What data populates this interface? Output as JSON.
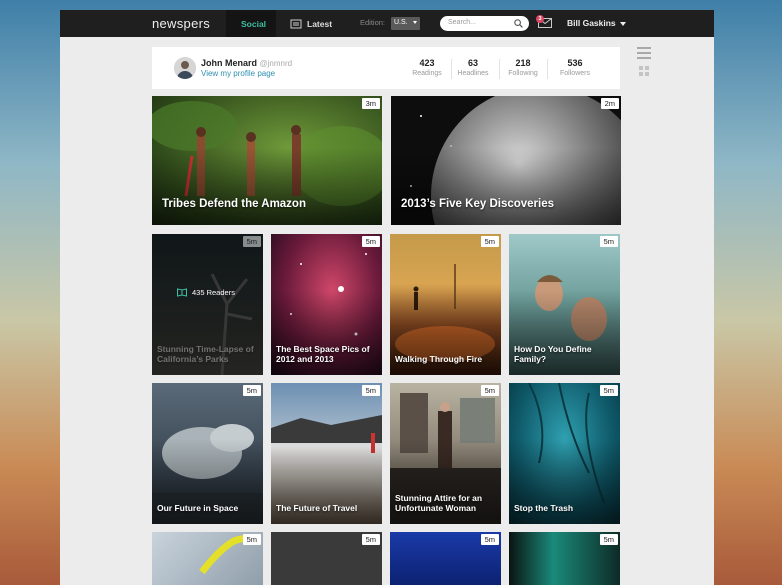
{
  "app": {
    "logo": "newspers",
    "tabs": [
      {
        "label": "Social",
        "active": true
      },
      {
        "label": "Latest",
        "active": false
      }
    ],
    "edition_label": "Edition:",
    "edition_value": "U.S.",
    "search_placeholder": "Search...",
    "notification_count": "3",
    "user_name": "Bill Gaskins",
    "accent_color": "#3fbfa3"
  },
  "profile": {
    "name": "John Menard",
    "handle": "@jnmnrd",
    "link": "View my profile page",
    "stats": [
      {
        "value": "423",
        "label": "Readings"
      },
      {
        "value": "63",
        "label": "Headlines"
      },
      {
        "value": "218",
        "label": "Following"
      },
      {
        "value": "536",
        "label": "Followers"
      }
    ]
  },
  "cards": [
    {
      "title": "Tribes Defend the Amazon",
      "time": "3m"
    },
    {
      "title": "2013’s Five Key Discoveries",
      "time": "2m"
    },
    {
      "title": "Stunning Time-Lapse of California’s Parks",
      "time": "5m",
      "readers": "435 Readers"
    },
    {
      "title": "The Best Space Pics of 2012 and 2013",
      "time": "5m"
    },
    {
      "title": "Walking Through Fire",
      "time": "5m"
    },
    {
      "title": "How Do You Define Family?",
      "time": "5m"
    },
    {
      "title": "Our Future in Space",
      "time": "5m"
    },
    {
      "title": "The Future of Travel",
      "time": "5m"
    },
    {
      "title": "Stunning Attire for an Unfortunate Woman",
      "time": "5m"
    },
    {
      "title": "Stop the Trash",
      "time": "5m"
    },
    {
      "title": "",
      "time": "5m"
    },
    {
      "title": "",
      "time": "5m"
    },
    {
      "title": "",
      "time": "5m"
    },
    {
      "title": "",
      "time": "5m"
    }
  ]
}
